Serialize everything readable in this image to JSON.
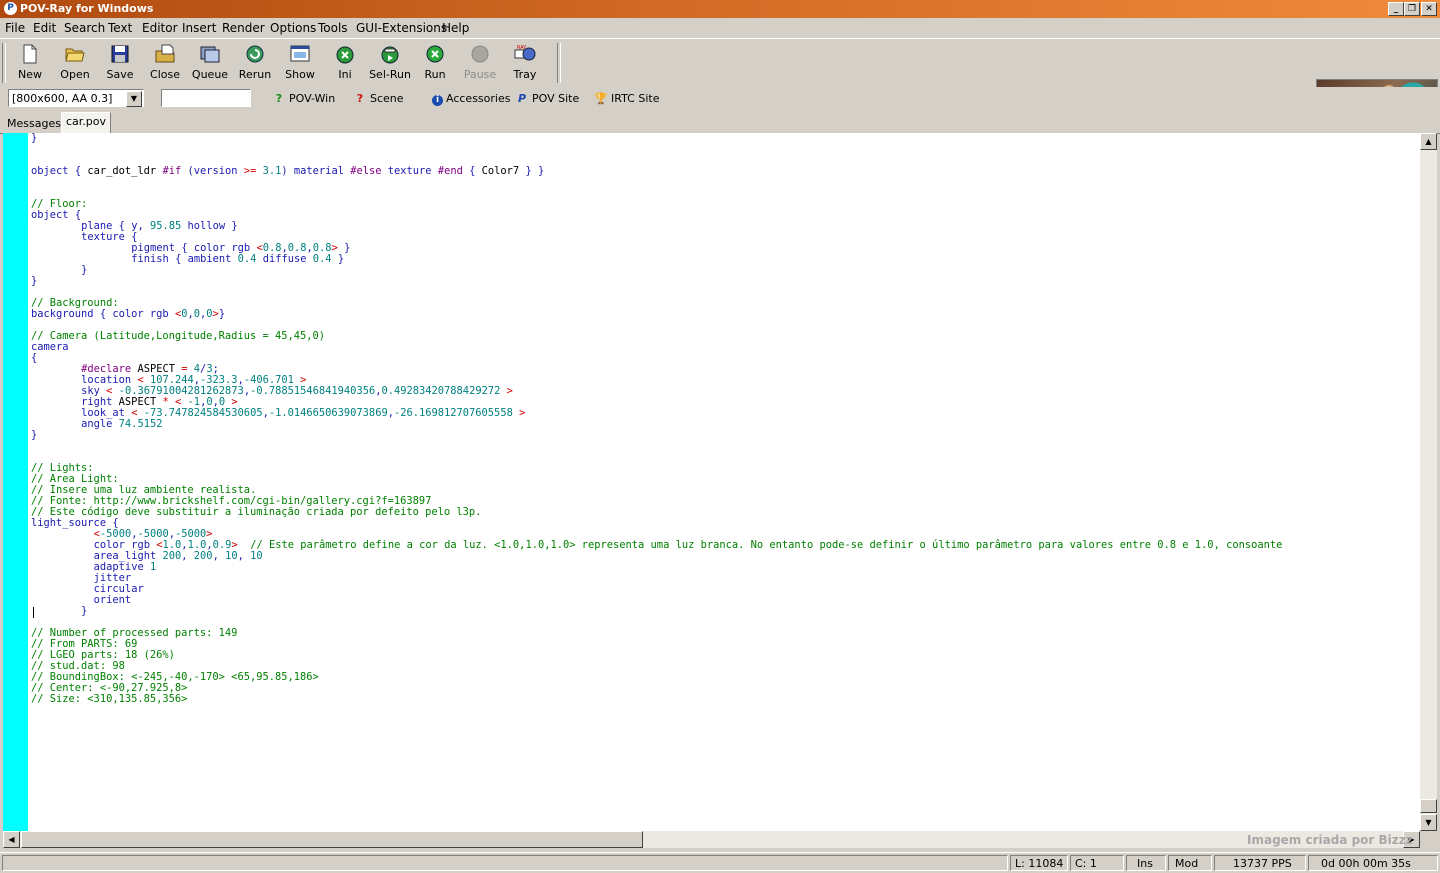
{
  "window": {
    "title": "POV-Ray for Windows",
    "app_icon": "P"
  },
  "menu": [
    "File",
    "Edit",
    "Search",
    "Text",
    "Editor",
    "Insert",
    "Render",
    "Options",
    "Tools",
    "GUI-Extensions",
    "Help"
  ],
  "toolbar": {
    "new": "New",
    "open": "Open",
    "save": "Save",
    "close": "Close",
    "queue": "Queue",
    "rerun": "Rerun",
    "show": "Show",
    "ini": "Ini",
    "selrun": "Sel-Run",
    "run": "Run",
    "pause": "Pause",
    "tray": "Tray"
  },
  "toolbar2": {
    "resolution": "[800x600, AA 0.3]",
    "command": "",
    "povwin": "POV-Win",
    "scene": "Scene",
    "accessories": "Accessories",
    "povsite": "POV Site",
    "irtcsite": "IRTC Site"
  },
  "tabs": [
    "Messages",
    "car.pov"
  ],
  "code": [
    "}",
    "",
    "",
    "object { car_dot_ldr #if (version >= 3.1) material #else texture #end { Color7 } }",
    "",
    "",
    "// Floor:",
    "object {",
    "        plane { y, 95.85 hollow }",
    "        texture {",
    "                pigment { color rgb <0.8,0.8,0.8> }",
    "                finish { ambient 0.4 diffuse 0.4 }",
    "        }",
    "}",
    "",
    "// Background:",
    "background { color rgb <0,0,0>}",
    "",
    "// Camera (Latitude,Longitude,Radius = 45,45,0)",
    "camera",
    "{",
    "        #declare ASPECT = 4/3;",
    "        location < 107.244,-323.3,-406.701 >",
    "        sky < -0.36791004281262873,-0.78851546841940356,0.49283420788429272 >",
    "        right ASPECT * < -1,0,0 >",
    "        look_at < -73.747824584530605,-1.0146650639073869,-26.169812707605558 >",
    "        angle 74.5152",
    "}",
    "",
    "",
    "// Lights:",
    "// Area Light:",
    "// Insere uma luz ambiente realista.",
    "// Fonte: http://www.brickshelf.com/cgi-bin/gallery.cgi?f=163897",
    "// Este código deve substituir a iluminação criada por defeito pelo l3p.",
    "light_source {",
    "          <-5000,-5000,-5000>",
    "          color rgb <1.0,1.0,0.9>  // Este parâmetro define a cor da luz. <1.0,1.0,1.0> representa uma luz branca. No entanto pode-se definir o último parâmetro para valores entre 0.8 e 1.0, consoante",
    "          area_light 200, 200, 10, 10",
    "          adaptive 1",
    "          jitter",
    "          circular",
    "          orient",
    "        }",
    "",
    "// Number of processed parts: 149",
    "// From PARTS: 69",
    "// LGEO parts: 18 (26%)",
    "// stud.dat: 98",
    "// BoundingBox: <-245,-40,-170> <65,95.85,186>",
    "// Center: <-90,27.925,8>",
    "// Size: <310,135.85,356>"
  ],
  "status": {
    "line": "L: 11084",
    "col": "C: 1",
    "ins": "Ins",
    "mod": "Mod",
    "pps": "13737 PPS",
    "time": "0d 00h 00m 35s"
  },
  "watermark": "Imagem criada por Bizzz",
  "colors": {
    "keyword": "#1a1ab0",
    "comment": "#008000",
    "number": "#008080",
    "operator": "#d00000",
    "directive": "#800080",
    "text": "#000000",
    "gutter": "#00ffff"
  }
}
